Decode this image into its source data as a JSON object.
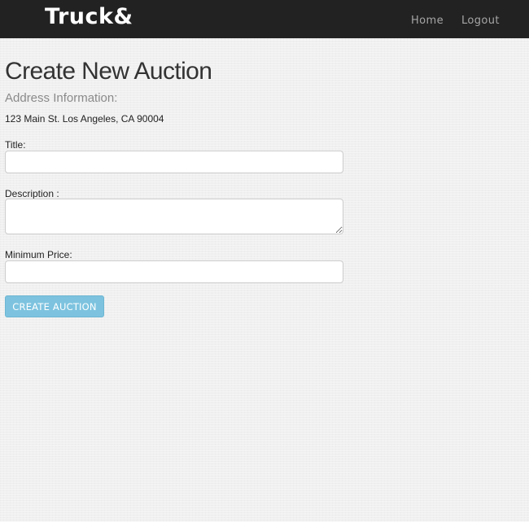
{
  "navbar": {
    "brand": "Truck&",
    "links": [
      {
        "label": "Home"
      },
      {
        "label": "Logout"
      }
    ]
  },
  "page": {
    "title": "Create New Auction",
    "address_heading": "Address Information:",
    "address": "123 Main St. Los Angeles, CA 90004"
  },
  "form": {
    "title_label": "Title:",
    "title_value": "",
    "description_label": "Description :",
    "description_value": "",
    "min_price_label": "Minimum Price:",
    "min_price_value": "",
    "submit_label": "CREATE AUCTION"
  },
  "colors": {
    "navbar_bg": "#222222",
    "button_bg": "#7dc3df",
    "page_bg": "#f0f0f0"
  }
}
